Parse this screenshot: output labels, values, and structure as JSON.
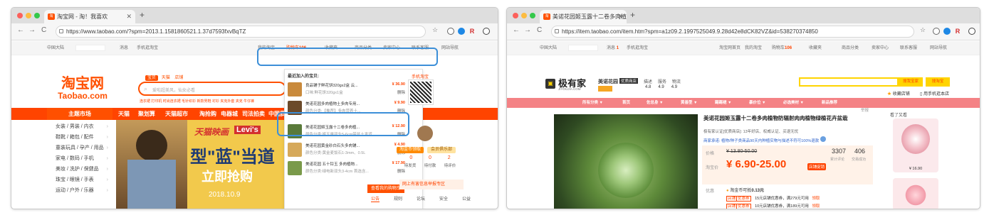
{
  "left": {
    "tab_title": "淘宝网 - 淘！我喜欢",
    "tab_favicon": "淘",
    "url": "https://www.taobao.com/?spm=2013.1.1581860521.1.37d7593fxvBqTZ",
    "topnav": {
      "region": "中国大陆",
      "messages": "消息",
      "mobile": "手机逛淘宝",
      "my_taobao": "我的淘宝",
      "cart": "购物车",
      "cart_count": "106",
      "favorites": "收藏夹",
      "categories": "商品分类",
      "seller_center": "卖家中心",
      "contact": "联系客服",
      "site_nav": "网站导航"
    },
    "logo_line1": "淘宝网",
    "logo_line2": "Taobao.com",
    "search_tabs": [
      "宝贝",
      "天猫",
      "店铺"
    ],
    "search_placeholder": "爱啦超美风，仙女必看",
    "hot_words": "连衣裙 打印机 时尚连衣裙 毛针织衫 新款男鞋 衬衫 夹克外套 夹克 牛仔裤",
    "theme_market": "主题市场",
    "main_nav": [
      "天猫",
      "聚划算",
      "天猫超市",
      "淘抢购",
      "电器城",
      "司法拍卖",
      "中国质造"
    ],
    "sidebar": [
      "女装 / 男装 / 内衣",
      "鞋靴 / 箱包 / 配件",
      "童装玩具 / 孕产 / 用品",
      "家电 / 数码 / 手机",
      "美妆 / 洗护 / 保健品",
      "珠宝 / 眼镜 / 手表",
      "运动 / 户外 / 乐器"
    ],
    "banner": {
      "brand1": "天猫映画",
      "brand2": "Levi's",
      "headline": "型\"蓝\"当道",
      "cta": "立即抢购",
      "date": "2018.10.9"
    },
    "dropdown": {
      "header": "最近加入的宝贝:",
      "delete_label": "删除",
      "items": [
        {
          "name": "良品铺子鲜花饼320gx2盒 云...",
          "spec": "口味:鲜花饼320gx1盒",
          "price": "¥ 36.90",
          "color": "#c98a3c"
        },
        {
          "name": "美诺花园多肉植物土多肉专用...",
          "spec": "颜色分类:【推荐】多肉营养土...",
          "price": "¥ 9.90",
          "color": "#6b4a2a"
        },
        {
          "name": "美诺花园姬玉露十二卷多肉植...",
          "spec": "颜色分类:姬玉露双头5-6cm带盆土发货",
          "price": "¥ 12.90",
          "color": "#5a7a3a"
        },
        {
          "name": "美诺花园黄金砂白石头多肉铺...",
          "spec": "颜色分类:黄金麦饭石1-3mm、0.5L",
          "price": "¥ 4.90",
          "color": "#d6a95a"
        },
        {
          "name": "美诺花园 五十铃玉 多肉植物...",
          "spec": "颜色分类:绿电新双头3-4cm 首选含...",
          "price": "¥ 17.90",
          "color": "#7a9a4a"
        }
      ],
      "view_cart": "查看我的购物车"
    },
    "mobile_taobao": "手机淘宝",
    "user_panel": {
      "btn1": "淘金币领取",
      "btn2": "会员俱乐部",
      "counts": [
        "0",
        "0",
        "2"
      ],
      "labels": [
        "待发货",
        "待付款",
        "待评价"
      ],
      "promo": "网上有害信息举报专区"
    },
    "notice_tabs": [
      "公告",
      "规则",
      "论坛",
      "安全",
      "公益"
    ]
  },
  "right": {
    "tab_title": "美诺花园姬玉露十二卷多肉植物",
    "tab_favicon": "淘",
    "url": "https://item.taobao.com/item.htm?spm=a1z09.2.1997525049.9.28d42e8dCK82VZ&id=538270374850",
    "topnav": {
      "region": "中国大陆",
      "messages": "消息",
      "msg_count": "1",
      "mobile": "手机逛淘宝",
      "home": "淘宝网首页",
      "my_taobao": "我的淘宝",
      "cart": "购物车",
      "cart_count": "106",
      "favorites": "收藏夹",
      "categories": "商品分类",
      "seller_center": "卖家中心",
      "contact": "联系客服",
      "site_nav": "网站导航"
    },
    "shop": {
      "logo_text": "极有家",
      "logo_sub": "JIYOUJIA.COM",
      "name": "美诺花园",
      "badge": "优质商店",
      "metrics_labels": [
        "描述",
        "服务",
        "物流"
      ],
      "metrics_values": [
        "4.8",
        "4.9",
        "4.9"
      ],
      "search_btn": "搜我宝家",
      "search_btn2": "搜淘宝",
      "fav_shop": "收藏店铺",
      "mobile_shop": "用手机逛本店"
    },
    "shop_nav": [
      "所有分类",
      "首页",
      "佐总身",
      "黄善型",
      "踢踢裙",
      "暴价位",
      "必选美材",
      "新品推荐"
    ],
    "product": {
      "title": "美诺花园姬玉露十二卷多肉植物防辐射肉肉植物绿植花卉盆栽",
      "subtitle": "极有家认证[优质商店]: 13年好店、权威认证、买退无忧",
      "promise": "商家承诺: 植物/种子类商品90天内种植实物与描述不符可100%退款",
      "price_label": "价格",
      "orig_price": "¥ 13.80-50.00",
      "promo_label": "淘宝价",
      "promo_price": "¥ 6.90-25.00",
      "promo_tag": "店铺促销",
      "reviews": "3307",
      "reviews_label": "累计评论",
      "sales": "406",
      "sales_label": "交易成功",
      "benefit_label": "优惠",
      "coin": "淘金币可抵",
      "coin_amount": "0.13元",
      "coupons": [
        {
          "tag": "店铺",
          "tag2": "优惠券",
          "text": "15元店铺优惠券，满279元可用",
          "link": "领取"
        },
        {
          "tag": "店铺",
          "tag2": "优惠券",
          "text": "10元店铺优惠券，满189元可用",
          "link": "领取"
        }
      ],
      "report": "举报"
    },
    "side_title": "看了又看",
    "side_price": "¥ 16.90"
  }
}
